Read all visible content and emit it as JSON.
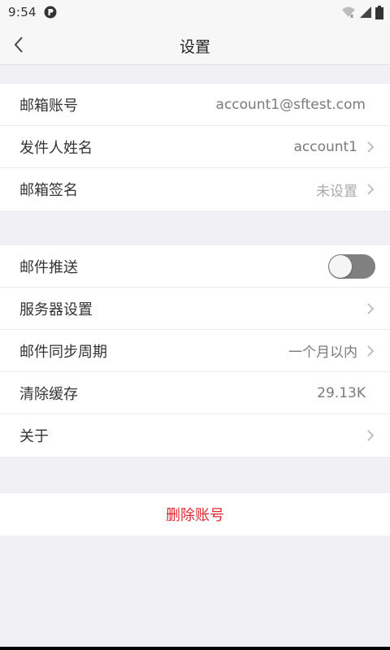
{
  "status_bar": {
    "time": "9:54"
  },
  "nav": {
    "title": "设置"
  },
  "group1": [
    {
      "label": "邮箱账号",
      "value": "account1@sftest.com"
    },
    {
      "label": "发件人姓名",
      "value": "account1"
    },
    {
      "label": "邮箱签名",
      "value": "未设置"
    }
  ],
  "group2": {
    "push": {
      "label": "邮件推送",
      "enabled": false
    },
    "server": {
      "label": "服务器设置"
    },
    "sync": {
      "label": "邮件同步周期",
      "value": "一个月以内"
    },
    "cache": {
      "label": "清除缓存",
      "value": "29.13K"
    },
    "about": {
      "label": "关于"
    }
  },
  "delete": {
    "label": "删除账号"
  },
  "colors": {
    "danger": "#e0282e",
    "toggle_off": "#808080",
    "background": "#efeff4"
  }
}
